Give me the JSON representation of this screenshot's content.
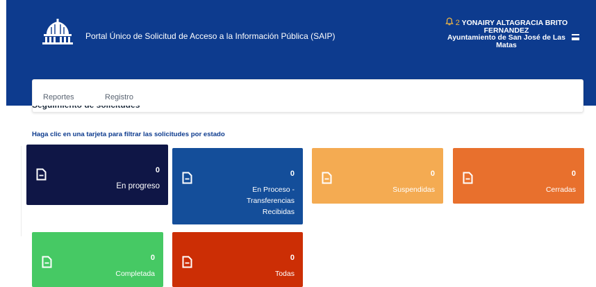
{
  "header": {
    "portal_title": "Portal Único de Solicitud de Acceso a la Información Pública (SAIP)",
    "notification_count": "2",
    "user_name": "YONAIRY ALTAGRACIA BRITO FERNANDEZ",
    "organization": "Ayuntamiento de San José de Las Matas"
  },
  "nav": {
    "items": [
      "Reportes",
      "Registro"
    ]
  },
  "main": {
    "section_title": "Seguimiento de solicitudes",
    "hint": "Haga clic en una tarjeta para filtrar las solicitudes por estado",
    "cards": [
      {
        "count": "0",
        "label": "En progreso",
        "color": "#0f1646"
      },
      {
        "count": "0",
        "label": "En Proceso - Transferencias Recibidas",
        "color": "#144e9a"
      },
      {
        "count": "0",
        "label": "Suspendidas",
        "color": "#f4ab52"
      },
      {
        "count": "0",
        "label": "Cerradas",
        "color": "#e8702d"
      },
      {
        "count": "0",
        "label": "Completada",
        "color": "#46c964"
      },
      {
        "count": "0",
        "label": "Todas",
        "color": "#cc2e05"
      }
    ]
  },
  "icons": {
    "logo": "government-building-icon",
    "notification": "bell-icon",
    "menu": "hamburger-icon",
    "card": "document-icon"
  }
}
